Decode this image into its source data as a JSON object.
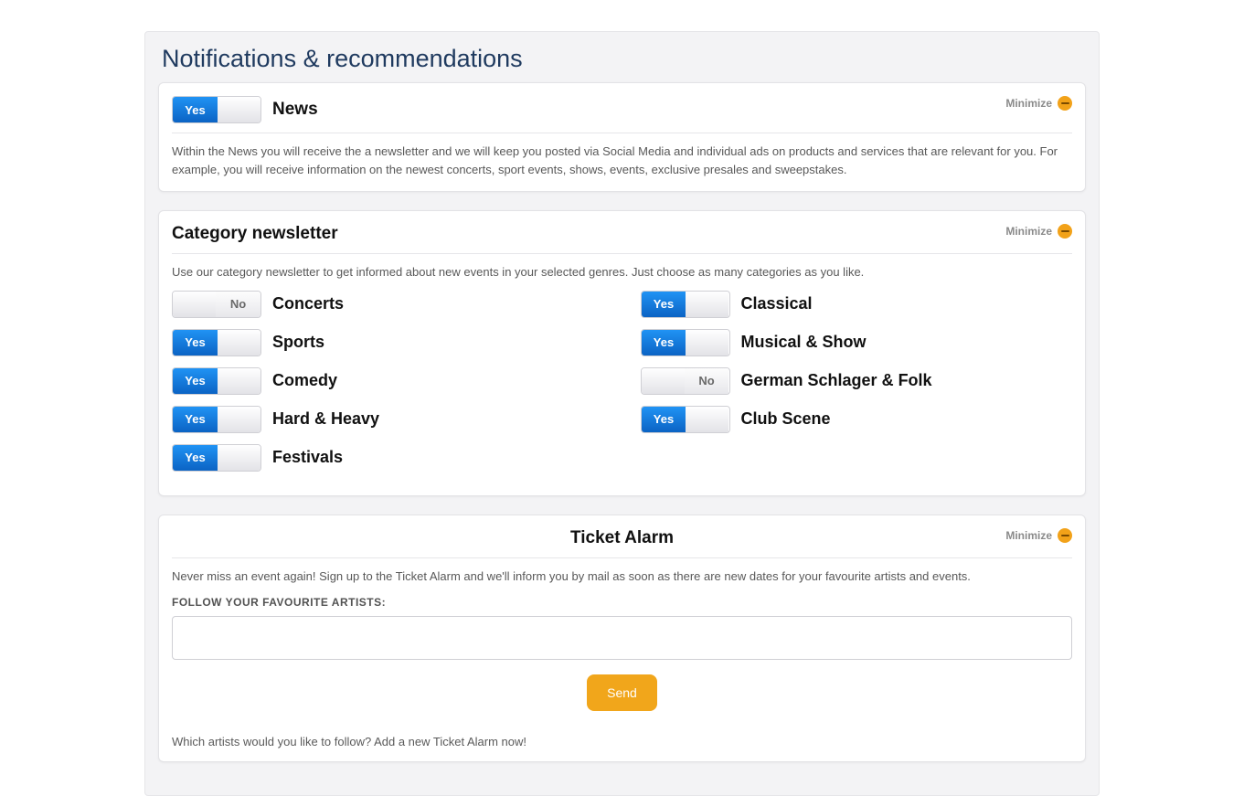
{
  "page": {
    "title": "Notifications & recommendations"
  },
  "labels": {
    "yes": "Yes",
    "no": "No",
    "minimize": "Minimize"
  },
  "news": {
    "title": "News",
    "state": "yes",
    "desc": "Within the News you will receive the a newsletter and we will keep you posted via Social Media and individual ads on products and services that are relevant for you. For example, you will receive information on the newest concerts, sport events, shows, events, exclusive presales and sweepstakes."
  },
  "category": {
    "title": "Category newsletter",
    "desc": "Use our category newsletter to get informed about new events in your selected genres. Just choose as many categories as you like.",
    "left": [
      {
        "label": "Concerts",
        "state": "no"
      },
      {
        "label": "Sports",
        "state": "yes"
      },
      {
        "label": "Comedy",
        "state": "yes"
      },
      {
        "label": "Hard & Heavy",
        "state": "yes"
      },
      {
        "label": "Festivals",
        "state": "yes"
      }
    ],
    "right": [
      {
        "label": "Classical",
        "state": "yes"
      },
      {
        "label": "Musical & Show",
        "state": "yes"
      },
      {
        "label": "German Schlager & Folk",
        "state": "no"
      },
      {
        "label": "Club Scene",
        "state": "yes"
      }
    ]
  },
  "ticket": {
    "title": "Ticket Alarm",
    "desc": "Never miss an event again! Sign up to the Ticket Alarm and we'll inform you by mail as soon as there are new dates for your favourite artists and events.",
    "followLabel": "FOLLOW YOUR FAVOURITE ARTISTS:",
    "send": "Send",
    "footer": "Which artists would you like to follow? Add a new Ticket Alarm now!",
    "inputValue": ""
  }
}
